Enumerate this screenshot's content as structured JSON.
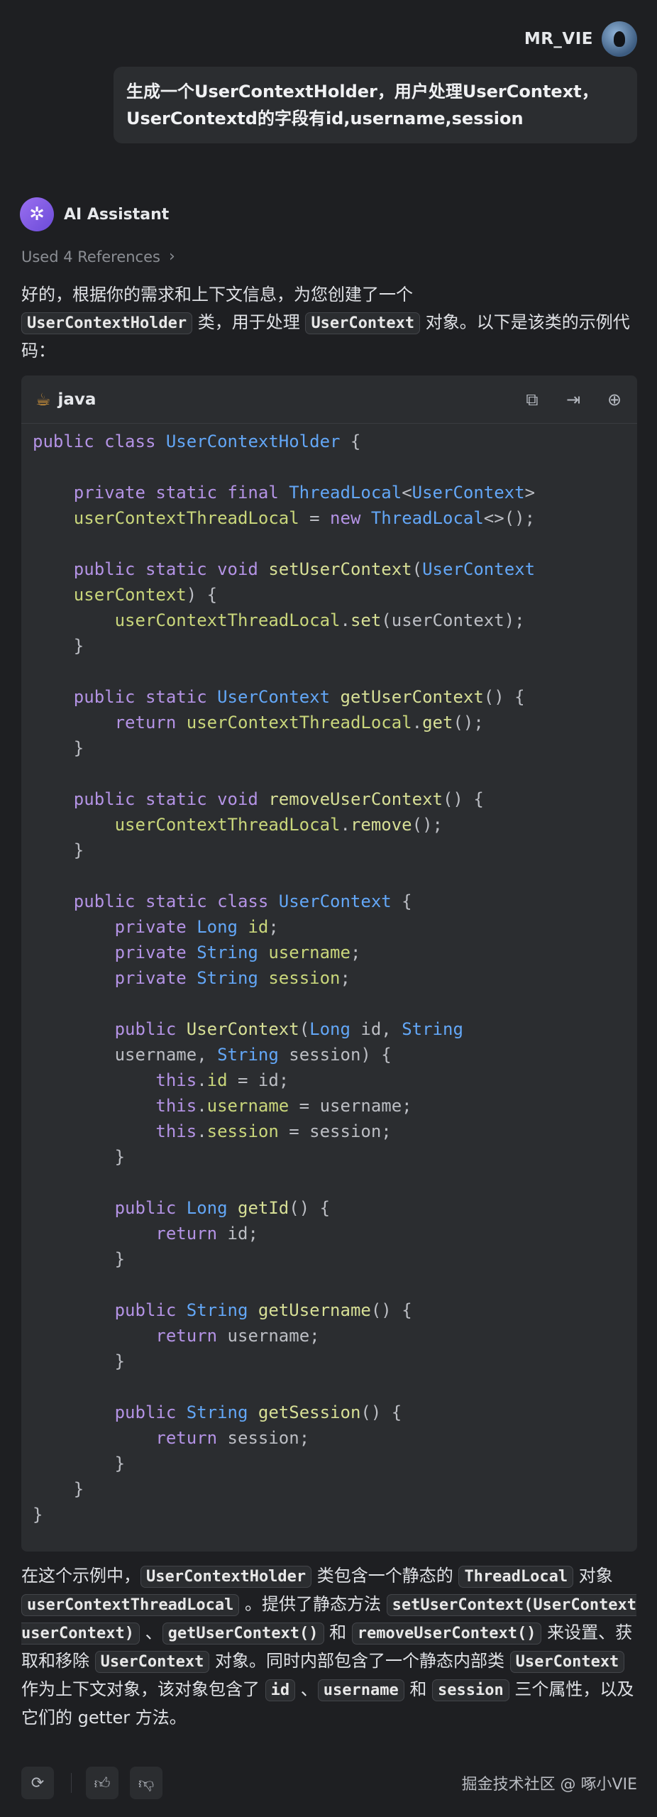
{
  "user": {
    "name": "MR_VIE",
    "message_line1": "生成一个UserContextHolder，用户处理UserContext，",
    "message_line2": "UserContextd的字段有id,username,session"
  },
  "assistant": {
    "name": "AI Assistant",
    "references": "Used 4 References",
    "intro_a": "好的，根据你的需求和上下文信息，为您创建了一个",
    "intro_code1": "UserContextHolder",
    "intro_b": " 类，用于处理 ",
    "intro_code2": "UserContext",
    "intro_c": " 对象。以下是该类的示例代码："
  },
  "code": {
    "language": "java",
    "lines": [
      [
        [
          "kw",
          "public class "
        ],
        [
          "ty",
          "UserContextHolder"
        ],
        [
          "pl",
          " {"
        ]
      ],
      [],
      [
        [
          "pl",
          "    "
        ],
        [
          "kw",
          "private static final "
        ],
        [
          "ty",
          "ThreadLocal"
        ],
        [
          "pl",
          "<"
        ],
        [
          "ty",
          "UserContext"
        ],
        [
          "pl",
          ">"
        ]
      ],
      [
        [
          "pl",
          "    "
        ],
        [
          "fd",
          "userContextThreadLocal"
        ],
        [
          "pl",
          " = "
        ],
        [
          "kw",
          "new "
        ],
        [
          "ty",
          "ThreadLocal"
        ],
        [
          "pl",
          "<>();"
        ]
      ],
      [],
      [
        [
          "pl",
          "    "
        ],
        [
          "kw",
          "public static void "
        ],
        [
          "fn",
          "setUserContext"
        ],
        [
          "pl",
          "("
        ],
        [
          "ty",
          "UserContext"
        ]
      ],
      [
        [
          "pl",
          "    "
        ],
        [
          "fd",
          "userContext"
        ],
        [
          "pl",
          ") {"
        ]
      ],
      [
        [
          "pl",
          "        "
        ],
        [
          "fd",
          "userContextThreadLocal"
        ],
        [
          "pl",
          "."
        ],
        [
          "fn",
          "set"
        ],
        [
          "pl",
          "(userContext);"
        ]
      ],
      [
        [
          "pl",
          "    }"
        ]
      ],
      [],
      [
        [
          "pl",
          "    "
        ],
        [
          "kw",
          "public static "
        ],
        [
          "ty",
          "UserContext "
        ],
        [
          "fn",
          "getUserContext"
        ],
        [
          "pl",
          "() {"
        ]
      ],
      [
        [
          "pl",
          "        "
        ],
        [
          "kw",
          "return "
        ],
        [
          "fd",
          "userContextThreadLocal"
        ],
        [
          "pl",
          "."
        ],
        [
          "fn",
          "get"
        ],
        [
          "pl",
          "();"
        ]
      ],
      [
        [
          "pl",
          "    }"
        ]
      ],
      [],
      [
        [
          "pl",
          "    "
        ],
        [
          "kw",
          "public static void "
        ],
        [
          "fn",
          "removeUserContext"
        ],
        [
          "pl",
          "() {"
        ]
      ],
      [
        [
          "pl",
          "        "
        ],
        [
          "fd",
          "userContextThreadLocal"
        ],
        [
          "pl",
          "."
        ],
        [
          "fn",
          "remove"
        ],
        [
          "pl",
          "();"
        ]
      ],
      [
        [
          "pl",
          "    }"
        ]
      ],
      [],
      [
        [
          "pl",
          "    "
        ],
        [
          "kw",
          "public static class "
        ],
        [
          "ty",
          "UserContext"
        ],
        [
          "pl",
          " {"
        ]
      ],
      [
        [
          "pl",
          "        "
        ],
        [
          "kw",
          "private "
        ],
        [
          "ty",
          "Long "
        ],
        [
          "fd",
          "id"
        ],
        [
          "pl",
          ";"
        ]
      ],
      [
        [
          "pl",
          "        "
        ],
        [
          "kw",
          "private "
        ],
        [
          "ty",
          "String "
        ],
        [
          "fd",
          "username"
        ],
        [
          "pl",
          ";"
        ]
      ],
      [
        [
          "pl",
          "        "
        ],
        [
          "kw",
          "private "
        ],
        [
          "ty",
          "String "
        ],
        [
          "fd",
          "session"
        ],
        [
          "pl",
          ";"
        ]
      ],
      [],
      [
        [
          "pl",
          "        "
        ],
        [
          "kw",
          "public "
        ],
        [
          "fn",
          "UserContext"
        ],
        [
          "pl",
          "("
        ],
        [
          "ty",
          "Long "
        ],
        [
          "pl",
          "id, "
        ],
        [
          "ty",
          "String"
        ]
      ],
      [
        [
          "pl",
          "        username, "
        ],
        [
          "ty",
          "String "
        ],
        [
          "pl",
          "session) {"
        ]
      ],
      [
        [
          "pl",
          "            "
        ],
        [
          "kw",
          "this"
        ],
        [
          "pl",
          "."
        ],
        [
          "fd",
          "id"
        ],
        [
          "pl",
          " = id;"
        ]
      ],
      [
        [
          "pl",
          "            "
        ],
        [
          "kw",
          "this"
        ],
        [
          "pl",
          "."
        ],
        [
          "fd",
          "username"
        ],
        [
          "pl",
          " = username;"
        ]
      ],
      [
        [
          "pl",
          "            "
        ],
        [
          "kw",
          "this"
        ],
        [
          "pl",
          "."
        ],
        [
          "fd",
          "session"
        ],
        [
          "pl",
          " = session;"
        ]
      ],
      [
        [
          "pl",
          "        }"
        ]
      ],
      [],
      [
        [
          "pl",
          "        "
        ],
        [
          "kw",
          "public "
        ],
        [
          "ty",
          "Long "
        ],
        [
          "fn",
          "getId"
        ],
        [
          "pl",
          "() {"
        ]
      ],
      [
        [
          "pl",
          "            "
        ],
        [
          "kw",
          "return "
        ],
        [
          "pl",
          "id;"
        ]
      ],
      [
        [
          "pl",
          "        }"
        ]
      ],
      [],
      [
        [
          "pl",
          "        "
        ],
        [
          "kw",
          "public "
        ],
        [
          "ty",
          "String "
        ],
        [
          "fn",
          "getUsername"
        ],
        [
          "pl",
          "() {"
        ]
      ],
      [
        [
          "pl",
          "            "
        ],
        [
          "kw",
          "return "
        ],
        [
          "pl",
          "username;"
        ]
      ],
      [
        [
          "pl",
          "        }"
        ]
      ],
      [],
      [
        [
          "pl",
          "        "
        ],
        [
          "kw",
          "public "
        ],
        [
          "ty",
          "String "
        ],
        [
          "fn",
          "getSession"
        ],
        [
          "pl",
          "() {"
        ]
      ],
      [
        [
          "pl",
          "            "
        ],
        [
          "kw",
          "return "
        ],
        [
          "pl",
          "session;"
        ]
      ],
      [
        [
          "pl",
          "        }"
        ]
      ],
      [
        [
          "pl",
          "    }"
        ]
      ],
      [
        [
          "pl",
          "}"
        ]
      ]
    ]
  },
  "explanation": [
    [
      "t",
      "在这个示例中，"
    ],
    [
      "c",
      "UserContextHolder"
    ],
    [
      "t",
      " 类包含一个静态的 "
    ],
    [
      "c",
      "ThreadLocal"
    ],
    [
      "t",
      " 对象 "
    ],
    [
      "c",
      "userContextThreadLocal"
    ],
    [
      "t",
      " 。提供了静态方法 "
    ],
    [
      "c",
      "setUserContext(UserContext userContext)"
    ],
    [
      "t",
      " 、"
    ],
    [
      "c",
      "getUserContext()"
    ],
    [
      "t",
      " 和 "
    ],
    [
      "c",
      "removeUserContext()"
    ],
    [
      "t",
      " 来设置、获取和移除 "
    ],
    [
      "c",
      "UserContext"
    ],
    [
      "t",
      " 对象。同时内部包含了一个静态内部类 "
    ],
    [
      "c",
      "UserContext"
    ],
    [
      "t",
      " 作为上下文对象，该对象包含了 "
    ],
    [
      "c",
      "id"
    ],
    [
      "t",
      " 、"
    ],
    [
      "c",
      "username"
    ],
    [
      "t",
      " 和 "
    ],
    [
      "c",
      "session"
    ],
    [
      "t",
      " 三个属性，以及它们的 getter 方法。"
    ]
  ],
  "footer": {
    "watermark": "掘金技术社区 @ 啄小VIE"
  },
  "icons": {
    "ai_avatar": "sparkle-icon",
    "lang": "coffee-cup-icon",
    "copy": "copy-icon",
    "insert": "insert-at-caret-icon",
    "new_file": "new-file-icon",
    "regenerate": "refresh-icon",
    "like": "thumbs-up-icon",
    "dislike": "thumbs-down-icon"
  },
  "colors": {
    "background": "#1e1f22",
    "surface": "#2b2d30",
    "keyword": "#b493e5",
    "type": "#63a7f7",
    "function": "#d7df96",
    "field": "#c9d67b"
  }
}
